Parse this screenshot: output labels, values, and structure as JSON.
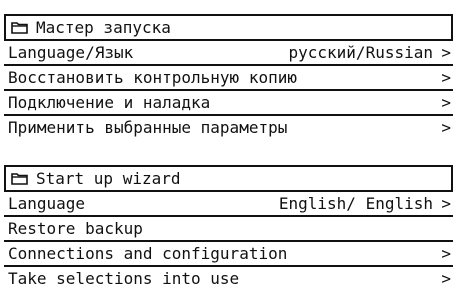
{
  "panels": [
    {
      "title": "Мастер запуска",
      "icon": "folder-icon",
      "items": [
        {
          "label": "Language/Язык",
          "value": "русский/Russian",
          "arrow": ">"
        },
        {
          "label": "Восстановить контрольную копию",
          "value": "",
          "arrow": ">"
        },
        {
          "label": "Подключение и наладка",
          "value": "",
          "arrow": ">"
        },
        {
          "label": "Применить выбранные параметры",
          "value": "",
          "arrow": ">"
        }
      ]
    },
    {
      "title": "Start up wizard",
      "icon": "folder-icon",
      "items": [
        {
          "label": "Language",
          "value": "English/ English",
          "arrow": ">"
        },
        {
          "label": "Restore backup",
          "value": "",
          "arrow": ""
        },
        {
          "label": "Connections and configuration",
          "value": "",
          "arrow": ">"
        },
        {
          "label": "Take selections into use",
          "value": "",
          "arrow": ">"
        }
      ]
    }
  ]
}
